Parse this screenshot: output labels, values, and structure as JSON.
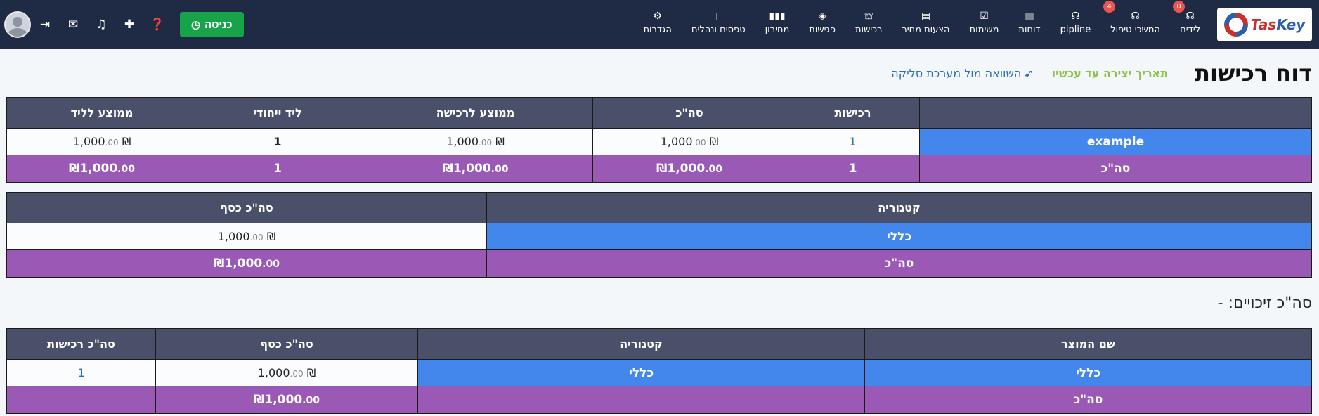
{
  "logo": {
    "text_a": "Tas",
    "text_b": "Key"
  },
  "nav": [
    {
      "label": "לידים",
      "icon": "☊",
      "badge": "0",
      "name": "nav-leads"
    },
    {
      "label": "המשכי טיפול",
      "icon": "☊",
      "badge": "4",
      "name": "nav-followups"
    },
    {
      "label": "pipline",
      "icon": "☊",
      "badge": "",
      "name": "nav-pipeline"
    },
    {
      "label": "דוחות",
      "icon": "▥",
      "badge": "",
      "name": "nav-reports"
    },
    {
      "label": "משימות",
      "icon": "☑",
      "badge": "",
      "name": "nav-tasks"
    },
    {
      "label": "הצעות מחיר",
      "icon": "▤",
      "badge": "",
      "name": "nav-quotes"
    },
    {
      "label": "רכישות",
      "icon": "⛫",
      "badge": "",
      "name": "nav-purchases"
    },
    {
      "label": "פגישות",
      "icon": "◈",
      "badge": "",
      "name": "nav-meetings"
    },
    {
      "label": "מחירון",
      "icon": "▮▮▮",
      "badge": "",
      "name": "nav-pricelist"
    },
    {
      "label": "טפסים ונהלים",
      "icon": "▯",
      "badge": "",
      "name": "nav-forms"
    },
    {
      "label": "הגדרות",
      "icon": "⚙",
      "badge": "",
      "name": "nav-settings"
    }
  ],
  "tools": {
    "checkin_label": "כניסה",
    "checkin_icon": "◷"
  },
  "header": {
    "title": "דוח רכישות",
    "date_range": "תאריך יצירה עד עכשיו",
    "compare_label": "השוואה מול מערכת סליקה"
  },
  "table1": {
    "headers": [
      "",
      "רכישות",
      "סה\"כ",
      "ממוצע לרכישה",
      "ליד ייחודי",
      "ממוצע לליד"
    ],
    "row": {
      "name": "example",
      "purchases": "1",
      "total": "1,000",
      "total_cents": ".00",
      "avg_purchase": "1,000",
      "avg_purchase_cents": ".00",
      "unique_lead": "1",
      "avg_lead": "1,000",
      "avg_lead_cents": ".00"
    },
    "total": {
      "label": "סה\"כ",
      "purchases": "1",
      "total": "₪1,000",
      "total_cents": ".00",
      "avg_purchase": "₪1,000",
      "avg_purchase_cents": ".00",
      "unique_lead": "1",
      "avg_lead": "₪1,000",
      "avg_lead_cents": ".00"
    }
  },
  "table2": {
    "headers": [
      "קטגוריה",
      "סה\"כ כסף"
    ],
    "row": {
      "category": "כללי",
      "money": "1,000",
      "money_cents": ".00"
    },
    "total": {
      "label": "סה\"כ",
      "money": "₪1,000",
      "money_cents": ".00"
    }
  },
  "credits": {
    "label": "סה\"כ זיכויים: -"
  },
  "table3": {
    "headers": [
      "שם המוצר",
      "קטגוריה",
      "סה\"כ כסף",
      "סה\"כ רכישות"
    ],
    "row": {
      "product": "כללי",
      "category": "כללי",
      "money": "1,000",
      "money_cents": ".00",
      "purchases": "1"
    },
    "total": {
      "label": "סה\"כ",
      "money": "₪1,000",
      "money_cents": ".00"
    }
  },
  "currency": "₪",
  "colors": {
    "topbar": "#1f2b45",
    "header": "#4a5069",
    "category": "#4387ec",
    "total": "#9b59b6",
    "checkin": "#16a34a"
  }
}
